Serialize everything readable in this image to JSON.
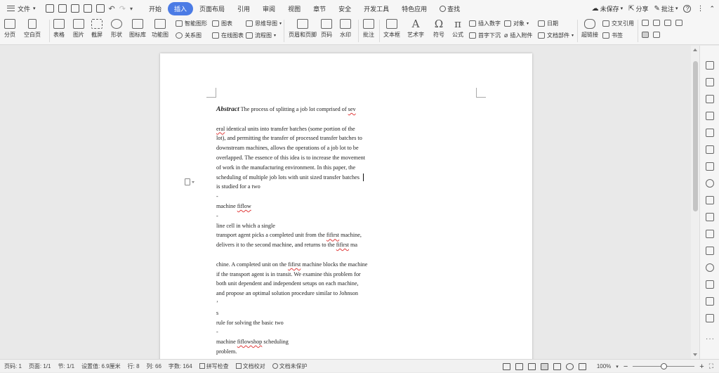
{
  "menubar": {
    "file_label": "文件",
    "tabs": [
      {
        "label": "开始",
        "active": false
      },
      {
        "label": "插入",
        "active": true
      },
      {
        "label": "页面布局",
        "active": false
      },
      {
        "label": "引用",
        "active": false
      },
      {
        "label": "审阅",
        "active": false
      },
      {
        "label": "视图",
        "active": false
      },
      {
        "label": "章节",
        "active": false
      },
      {
        "label": "安全",
        "active": false
      },
      {
        "label": "开发工具",
        "active": false
      },
      {
        "label": "特色应用",
        "active": false
      },
      {
        "label": "查找",
        "active": false
      }
    ],
    "unsaved_label": "未保存",
    "share_label": "分享",
    "comment_label": "批注",
    "accent_color": "#4b7be5"
  },
  "ribbon": {
    "page_break": "分页",
    "blank_page": "空白页",
    "table": "表格",
    "picture": "图片",
    "screenshot": "截屏",
    "shape": "形状",
    "icon_library": "图标库",
    "function_chart": "功能图",
    "smart_graphic": "智能图形",
    "chart": "图表",
    "mind_map": "思维导图",
    "relation_chart": "关系图",
    "online_chart": "在线图表",
    "flowchart": "流程图",
    "header_footer": "页眉和页脚",
    "page_number": "页码",
    "watermark": "水印",
    "comment": "批注",
    "textbox": "文本框",
    "wordart": "艺术字",
    "symbol": "符号",
    "formula": "公式",
    "insert_number": "插入数字",
    "object": "对象",
    "date": "日期",
    "drop_cap": "首字下沉",
    "attachment": "插入附件",
    "doc_parts": "文档部件",
    "hyperlink": "超链接",
    "cross_ref": "交叉引用",
    "bookmark": "书签"
  },
  "document": {
    "abstract_label": "Abstract",
    "lines": [
      {
        "pre": " The process of splitting a job lot comprised of ",
        "err": "sev",
        "post": ""
      },
      {
        "pre": "",
        "err": "",
        "post": ""
      },
      {
        "pre": "",
        "err": "eral",
        "post": " identical units into transfer batches (some portion of the"
      },
      {
        "pre": "lot), and permitting the transfer of processed transfer batches to",
        "err": "",
        "post": ""
      },
      {
        "pre": "downstream machines, allows the operations of a job lot to be",
        "err": "",
        "post": ""
      },
      {
        "pre": "overlapped. The essence of this idea is to increase the movement",
        "err": "",
        "post": ""
      },
      {
        "pre": "of work in the manufacturing environment. In this paper, the",
        "err": "",
        "post": ""
      },
      {
        "pre": "scheduling of multiple job lots with unit sized transfer batches",
        "err": "",
        "post": ""
      },
      {
        "pre": "is studied for a two",
        "err": "",
        "post": ""
      },
      {
        "pre": "-",
        "err": "",
        "post": ""
      },
      {
        "pre": "machine ",
        "err": "fiflow",
        "post": ""
      },
      {
        "pre": "-",
        "err": "",
        "post": ""
      },
      {
        "pre": "line cell in which a single",
        "err": "",
        "post": ""
      },
      {
        "pre": "transport agent picks a completed unit from the ",
        "err": "fifirst",
        "post": " machine,"
      },
      {
        "pre": "delivers it to the second machine, and returns to the ",
        "err": "fifirst",
        "post": " ma"
      },
      {
        "pre": "",
        "err": "",
        "post": ""
      },
      {
        "pre": "chine. A completed unit on the ",
        "err": "fifirst",
        "post": " machine blocks the machine"
      },
      {
        "pre": "if the transport agent is in transit. We examine this problem for",
        "err": "",
        "post": ""
      },
      {
        "pre": "both unit dependent and independent setups on each machine,",
        "err": "",
        "post": ""
      },
      {
        "pre": "and propose an optimal solution procedure similar to Johnson",
        "err": "",
        "post": ""
      },
      {
        "pre": "’",
        "err": "",
        "post": ""
      },
      {
        "pre": "s",
        "err": "",
        "post": ""
      },
      {
        "pre": "rule for solving the basic two",
        "err": "",
        "post": ""
      },
      {
        "pre": "-",
        "err": "",
        "post": ""
      },
      {
        "pre": "machine ",
        "err": "fiflowshop",
        "post": " scheduling"
      },
      {
        "pre": "problem.",
        "err": "",
        "post": ""
      }
    ]
  },
  "statusbar": {
    "page_num": "页码: 1",
    "pages": "页面: 1/1",
    "section": "节: 1/1",
    "setting": "设置值: 6.9厘米",
    "row": "行: 8",
    "col": "列: 66",
    "word_count": "字数: 164",
    "spell_check": "拼写检查",
    "doc_proof": "文档校对",
    "doc_unprotected": "文档未保护",
    "zoom": "100%",
    "zoom_level": 0.5
  }
}
